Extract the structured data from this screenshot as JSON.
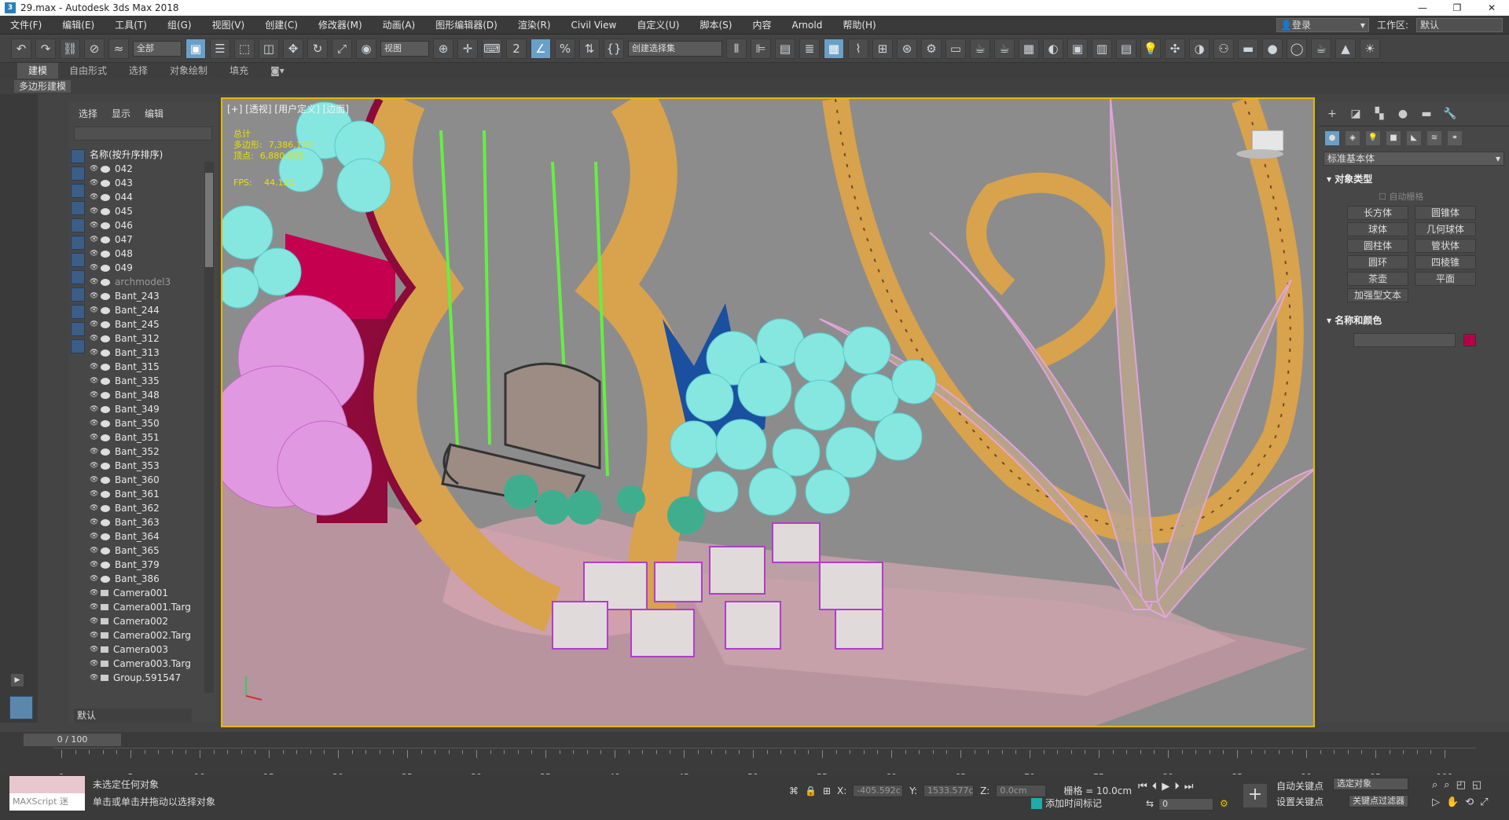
{
  "window": {
    "title": "29.max - Autodesk 3ds Max 2018",
    "icon": "3",
    "controls": [
      "—",
      "❐",
      "✕"
    ]
  },
  "menu": [
    "文件(F)",
    "编辑(E)",
    "工具(T)",
    "组(G)",
    "视图(V)",
    "创建(C)",
    "修改器(M)",
    "动画(A)",
    "图形编辑器(D)",
    "渲染(R)",
    "Civil View",
    "自定义(U)",
    "脚本(S)",
    "内容",
    "Arnold",
    "帮助(H)"
  ],
  "login": "登录",
  "workspace_label": "工作区:",
  "workspace_value": "默认",
  "toolbar": {
    "filter_dropdown": "全部",
    "view_dropdown": "视图",
    "selection_set_dropdown": "创建选择集"
  },
  "ribbon_tabs": [
    "建模",
    "自由形式",
    "选择",
    "对象绘制",
    "填充"
  ],
  "subribbon": "多边形建模",
  "scene_explorer": {
    "tabs": [
      "选择",
      "显示",
      "编辑"
    ],
    "header": "名称(按升序排序)",
    "rows": [
      "042",
      "043",
      "044",
      "045",
      "046",
      "047",
      "048",
      "049",
      "archmodel3",
      "Bant_243",
      "Bant_244",
      "Bant_245",
      "Bant_312",
      "Bant_313",
      "Bant_315",
      "Bant_335",
      "Bant_348",
      "Bant_349",
      "Bant_350",
      "Bant_351",
      "Bant_352",
      "Bant_353",
      "Bant_360",
      "Bant_361",
      "Bant_362",
      "Bant_363",
      "Bant_364",
      "Bant_365",
      "Bant_379",
      "Bant_386",
      "Camera001",
      "Camera001.Targ",
      "Camera002",
      "Camera002.Targ",
      "Camera003",
      "Camera003.Targ",
      "Group.591547"
    ],
    "footer": "默认"
  },
  "viewport": {
    "label": "[+] [透视] [用户定义] [边面]",
    "stats": [
      {
        "name": "总计",
        "value": ""
      },
      {
        "name": "多边形:",
        "value": "7,386,112"
      },
      {
        "name": "顶点:",
        "value": "6,880,005"
      }
    ],
    "fps_label": "FPS:",
    "fps_value": "44.121"
  },
  "command_panel": {
    "category_dropdown": "标准基本体",
    "object_type_title": "对象类型",
    "autogrid": "自动栅格",
    "object_buttons": [
      "长方体",
      "圆锥体",
      "球体",
      "几何球体",
      "圆柱体",
      "管状体",
      "圆环",
      "四棱锥",
      "茶壶",
      "平面",
      "加强型文本"
    ],
    "name_color_title": "名称和颜色",
    "object_color": "#b8004a"
  },
  "timeline": {
    "frame_counter": "0 / 100",
    "ticks": [
      "0",
      "5",
      "10",
      "15",
      "20",
      "25",
      "30",
      "35",
      "40",
      "45",
      "50",
      "55",
      "60",
      "65",
      "70",
      "75",
      "80",
      "85",
      "90",
      "95",
      "100"
    ]
  },
  "status": {
    "maxscript": "MAXScript 迷",
    "line1": "未选定任何对象",
    "line2": "单击或单击并拖动以选择对象",
    "x_label": "X:",
    "x_value": "-405.592c",
    "y_label": "Y:",
    "y_value": "1533.577c",
    "z_label": "Z:",
    "z_value": "0.0cm",
    "grid": "栅格 = 10.0cm",
    "add_time_tag": "添加时间标记",
    "auto_key": "自动关键点",
    "set_key": "设置关键点",
    "selected_object": "选定对象",
    "key_filters": "关键点过滤器",
    "frame_field": "0"
  }
}
